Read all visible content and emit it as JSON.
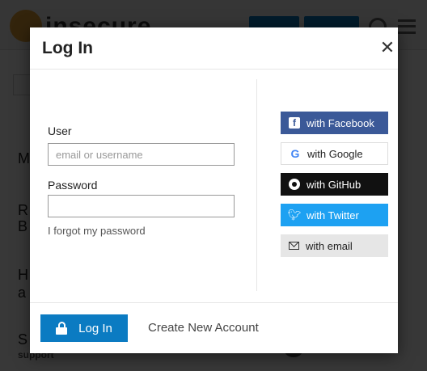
{
  "background": {
    "logo_text": "insecure",
    "rows": [
      "M",
      "R",
      "B",
      "H",
      "a",
      "S"
    ],
    "footer_tag": "support"
  },
  "modal": {
    "title": "Log In",
    "close_glyph": "✕",
    "user_label": "User",
    "user_placeholder": "email or username",
    "user_value": "",
    "password_label": "Password",
    "password_value": "",
    "forgot_label": "I forgot my password",
    "social": [
      {
        "label": "with Facebook",
        "icon": "facebook-icon",
        "color": "#3b5998"
      },
      {
        "label": "with Google",
        "icon": "google-icon",
        "color": "#ffffff"
      },
      {
        "label": "with GitHub",
        "icon": "github-icon",
        "color": "#111111"
      },
      {
        "label": "with Twitter",
        "icon": "twitter-icon",
        "color": "#1da1f2"
      },
      {
        "label": "with email",
        "icon": "envelope-icon",
        "color": "#e6e6e6"
      }
    ],
    "login_button": "Log In",
    "create_account": "Create New Account",
    "accent": "#0b7bc2"
  }
}
